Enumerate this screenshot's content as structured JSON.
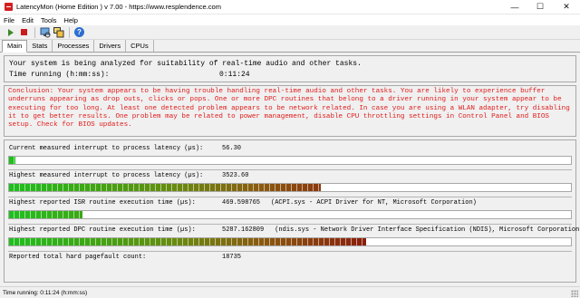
{
  "window": {
    "title": "LatencyMon  (Home Edition )  v 7.00 - https://www.resplendence.com",
    "controls": {
      "minimize": "—",
      "maximize": "☐",
      "close": "✕"
    }
  },
  "menu": [
    "File",
    "Edit",
    "Tools",
    "Help"
  ],
  "toolbar": {
    "icons": [
      "play-icon",
      "stop-icon",
      "monitor-icon",
      "windows-icon",
      "help-icon"
    ],
    "help_glyph": "?"
  },
  "tabs": [
    "Main",
    "Stats",
    "Processes",
    "Drivers",
    "CPUs"
  ],
  "active_tab": "Main",
  "status": {
    "analyzing_text": "Your system is being analyzed for suitability of real-time audio and other tasks.",
    "time_label": "Time running (h:mm:ss):",
    "time_value": "0:11:24"
  },
  "conclusion": "Conclusion: Your system appears to be having trouble handling real-time audio and other tasks. You are likely to experience buffer underruns appearing as drop outs, clicks or pops. One or more DPC routines that belong to a driver running in your system appear to be executing for too long. At least one detected problem appears to be network related. In case you are using a WLAN adapter, try disabling it to get better results. One problem may be related to power management, disable CPU throttling settings in Control Panel and BIOS setup. Check for BIOS updates.",
  "metrics": [
    {
      "label": "Current measured interrupt to process latency (µs):",
      "value": "56.30",
      "detail": "",
      "fill_fraction": 0.012
    },
    {
      "label": "Highest measured interrupt to process latency (µs):",
      "value": "3523.60",
      "detail": "",
      "fill_fraction": 0.555
    },
    {
      "label": "Highest reported ISR routine execution time (µs):",
      "value": "469.598765",
      "detail": "(ACPI.sys - ACPI Driver for NT, Microsoft Corporation)",
      "fill_fraction": 0.13
    },
    {
      "label": "Highest reported DPC routine execution time (µs):",
      "value": "5287.162809",
      "detail": "(ndis.sys - Network Driver Interface Specification (NDIS), Microsoft Corporation)",
      "fill_fraction": 0.635
    },
    {
      "label": "Reported total hard pagefault count:",
      "value": "18735",
      "detail": ""
    }
  ],
  "statusbar": "Time running: 0:11:24 (h:mm:ss)",
  "colors": {
    "conclusion_text": "#e21b1b",
    "bar_green": "#1fbf1f",
    "bar_dark_red": "#8a1a0a"
  }
}
